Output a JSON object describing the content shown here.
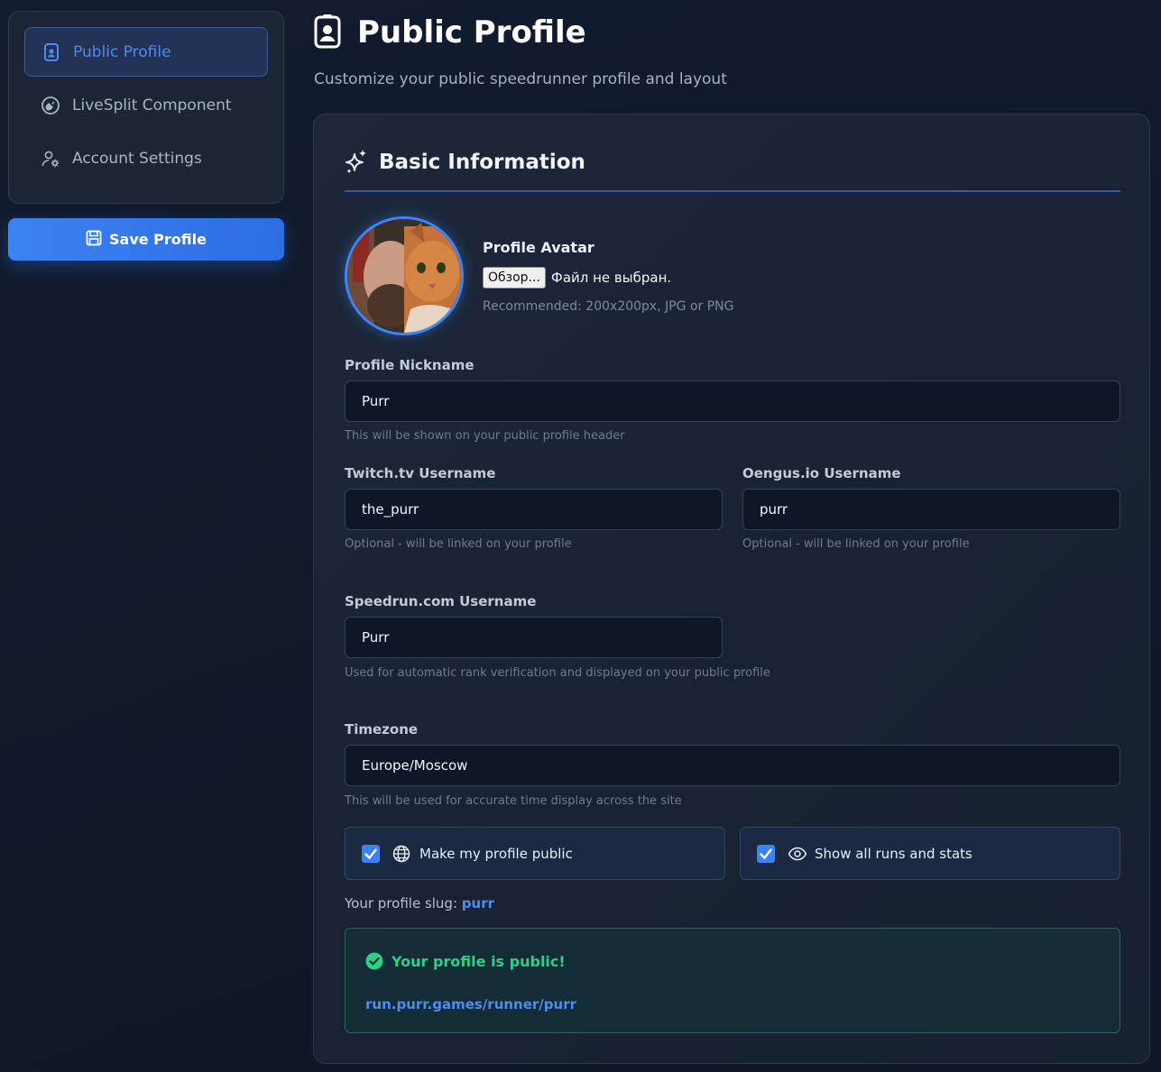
{
  "sidebar": {
    "items": [
      {
        "label": "Public Profile",
        "icon": "id-badge-icon",
        "active": true
      },
      {
        "label": "LiveSplit Component",
        "icon": "plug-circle-icon",
        "active": false
      },
      {
        "label": "Account Settings",
        "icon": "user-gear-icon",
        "active": false
      }
    ],
    "save_label": "Save Profile"
  },
  "header": {
    "title": "Public Profile",
    "subtitle": "Customize your public speedrunner profile and layout"
  },
  "basic_info": {
    "title": "Basic Information",
    "avatar": {
      "label": "Profile Avatar",
      "browse_button": "Обзор...",
      "no_file": "Файл не выбран.",
      "hint": "Recommended: 200x200px, JPG or PNG"
    },
    "nickname": {
      "label": "Profile Nickname",
      "value": "Purr",
      "hint": "This will be shown on your public profile header"
    },
    "twitch": {
      "label": "Twitch.tv Username",
      "value": "the_purr",
      "hint": "Optional - will be linked on your profile"
    },
    "oengus": {
      "label": "Oengus.io Username",
      "value": "purr",
      "hint": "Optional - will be linked on your profile"
    },
    "speedrun": {
      "label": "Speedrun.com Username",
      "value": "Purr",
      "hint": "Used for automatic rank verification and displayed on your public profile"
    },
    "timezone": {
      "label": "Timezone",
      "value": "Europe/Moscow",
      "hint": "This will be used for accurate time display across the site"
    },
    "make_public": {
      "label": "Make my profile public",
      "checked": true
    },
    "show_runs": {
      "label": "Show all runs and stats",
      "checked": true
    },
    "slug": {
      "prefix": "Your profile slug:",
      "value": "purr"
    },
    "public_notice": {
      "title": "Your profile is public!",
      "link": "run.purr.games/runner/purr"
    }
  },
  "colors": {
    "accent": "#3d82f2",
    "success": "#2fcf85",
    "background": "#101a2c"
  }
}
